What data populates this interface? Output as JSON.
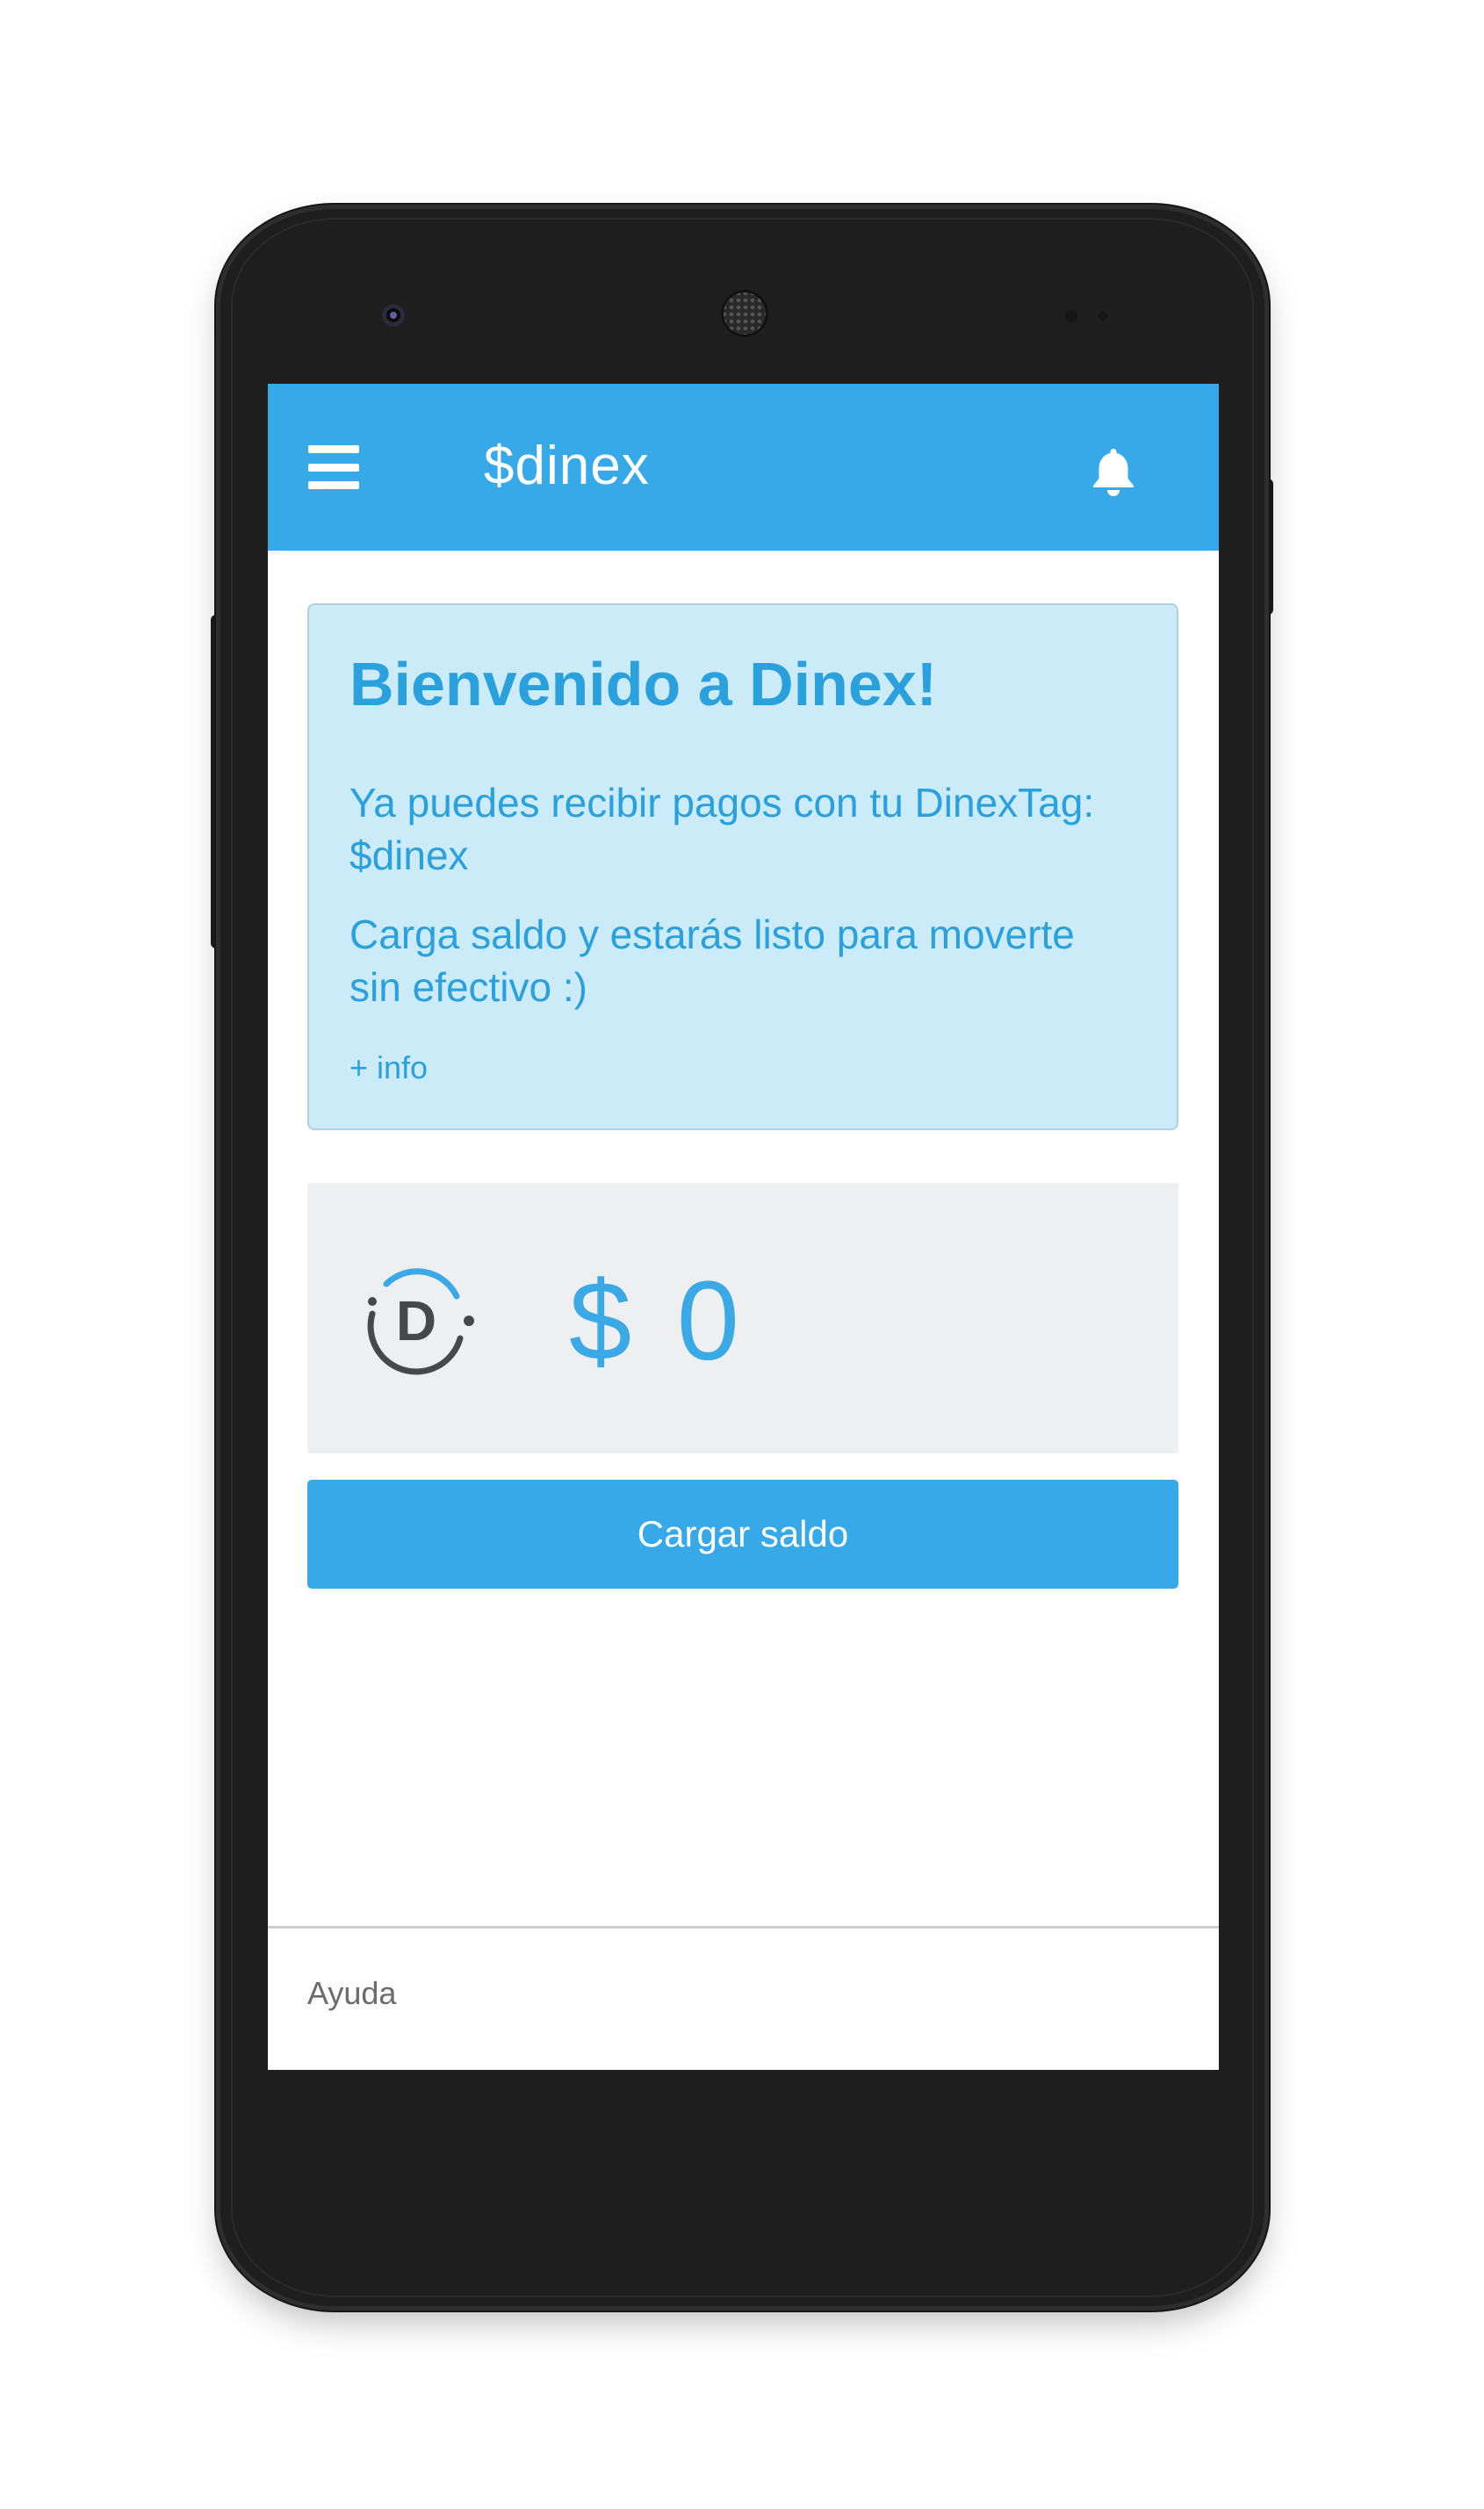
{
  "appbar": {
    "menu_icon": "hamburger-menu-icon",
    "title": "$dinex",
    "notifications_icon": "bell-icon",
    "color": "#38a9e8"
  },
  "welcome": {
    "title": "Bienvenido a Dinex!",
    "line1": "Ya puedes recibir pagos con tu DinexTag: $dinex",
    "line2": "Carga saldo y estarás listo para moverte sin efectivo :)",
    "more_link": "+ info",
    "background": "#ccebf9",
    "text_color": "#2aa0dd"
  },
  "balance": {
    "logo_letter": "D",
    "amount": "$ 0",
    "amount_color": "#3aa9e6"
  },
  "actions": {
    "load_balance_label": "Cargar saldo"
  },
  "footer": {
    "help_label": "Ayuda"
  }
}
